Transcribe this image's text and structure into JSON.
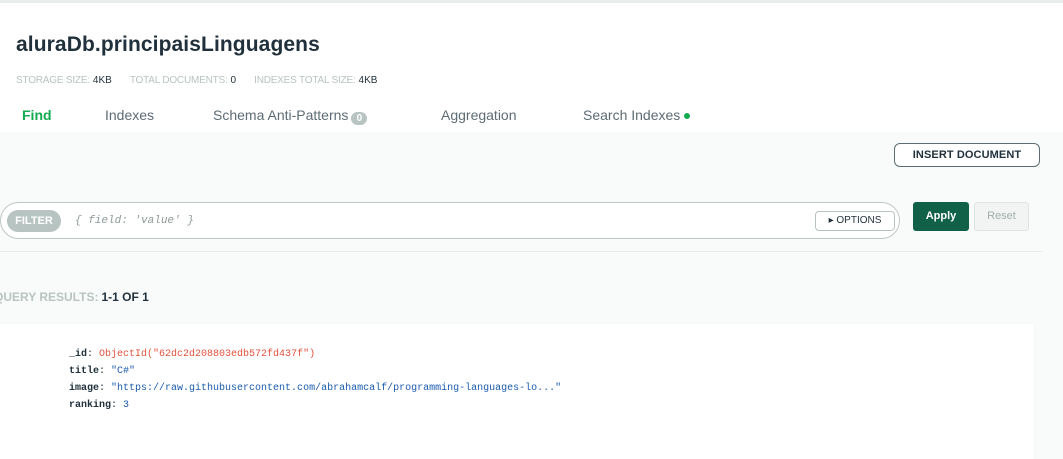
{
  "header": {
    "title": "aluraDb.principaisLinguagens",
    "stats": [
      {
        "label": "STORAGE SIZE:",
        "value": "4KB"
      },
      {
        "label": "TOTAL DOCUMENTS:",
        "value": "0"
      },
      {
        "label": "INDEXES TOTAL SIZE:",
        "value": "4KB"
      }
    ]
  },
  "tabs": [
    {
      "label": "Find",
      "active": true
    },
    {
      "label": "Indexes"
    },
    {
      "label": "Schema Anti-Patterns",
      "badge": "0"
    },
    {
      "label": "Aggregation"
    },
    {
      "label": "Search Indexes",
      "indicator": "green-dot"
    }
  ],
  "toolbar": {
    "insert_label": "INSERT DOCUMENT"
  },
  "filter": {
    "pill_label": "FILTER",
    "placeholder": "{ field: 'value' }",
    "options_label": "▸ OPTIONS",
    "apply_label": "Apply",
    "reset_label": "Reset"
  },
  "results": {
    "label": "QUERY RESULTS:",
    "value": "1-1 OF 1"
  },
  "document": {
    "fields": [
      {
        "key": "_id",
        "value": "ObjectId(\"62dc2d208803edb572fd437f\")",
        "type": "objectid"
      },
      {
        "key": "title",
        "value": "\"C#\"",
        "type": "string"
      },
      {
        "key": "image",
        "value": "\"https://raw.githubusercontent.com/abrahamcalf/programming-languages-lo...\"",
        "type": "string"
      },
      {
        "key": "ranking",
        "value": "3",
        "type": "number"
      }
    ]
  },
  "colors": {
    "accent_green": "#13aa52",
    "apply_green": "#116149",
    "objectid_red": "#e2523c",
    "string_blue": "#1a5cae"
  }
}
